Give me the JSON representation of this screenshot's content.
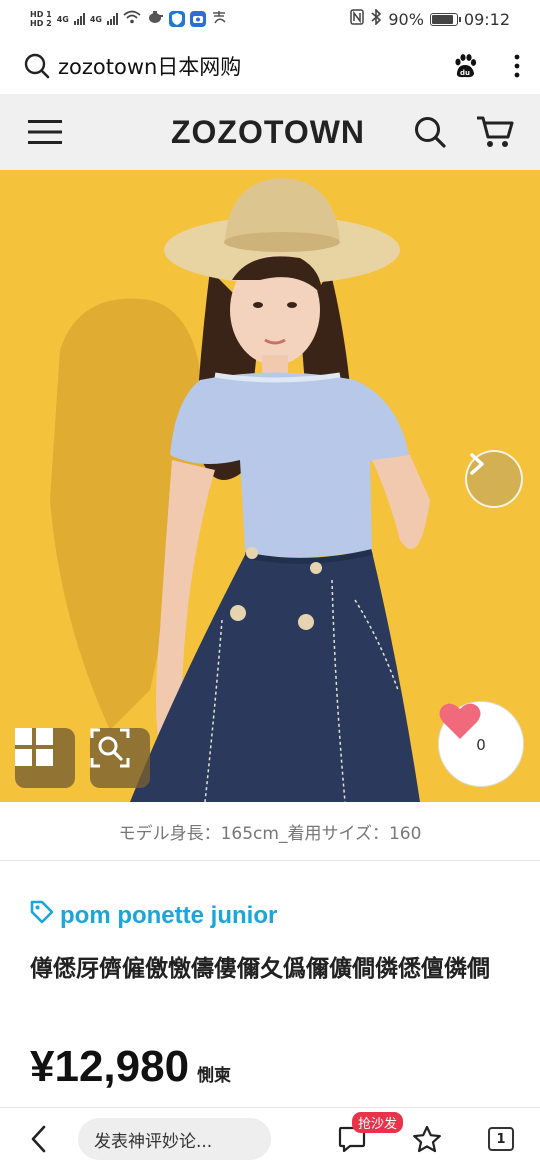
{
  "status_bar": {
    "sim1": "HD 1",
    "sim2": "HD 2",
    "net1": "4G",
    "net2": "4G",
    "battery_percent": "90%",
    "battery_level": 0.9,
    "time": "09:12"
  },
  "browser": {
    "query": "zozotown日本网购"
  },
  "site": {
    "logo": "ZOZOTOWN"
  },
  "product": {
    "like_count": "0",
    "model_info": "モデル身長：165cm_着用サイズ：160",
    "brand": "pom ponette junior",
    "name": "僔僁厊儕僱儌憿儔僂儞夂僞儞儣僴僯僁儃僯僴",
    "price": "¥12,980",
    "tax_label": "惻柬"
  },
  "bottom_bar": {
    "comment_placeholder": "发表神评妙论...",
    "hot_badge": "抢沙发",
    "tab_count": "1"
  },
  "colors": {
    "hero_bg": "#f4c23b",
    "brand": "#1aa6d9",
    "heart": "#f06a7c",
    "badge": "#e8334a"
  }
}
